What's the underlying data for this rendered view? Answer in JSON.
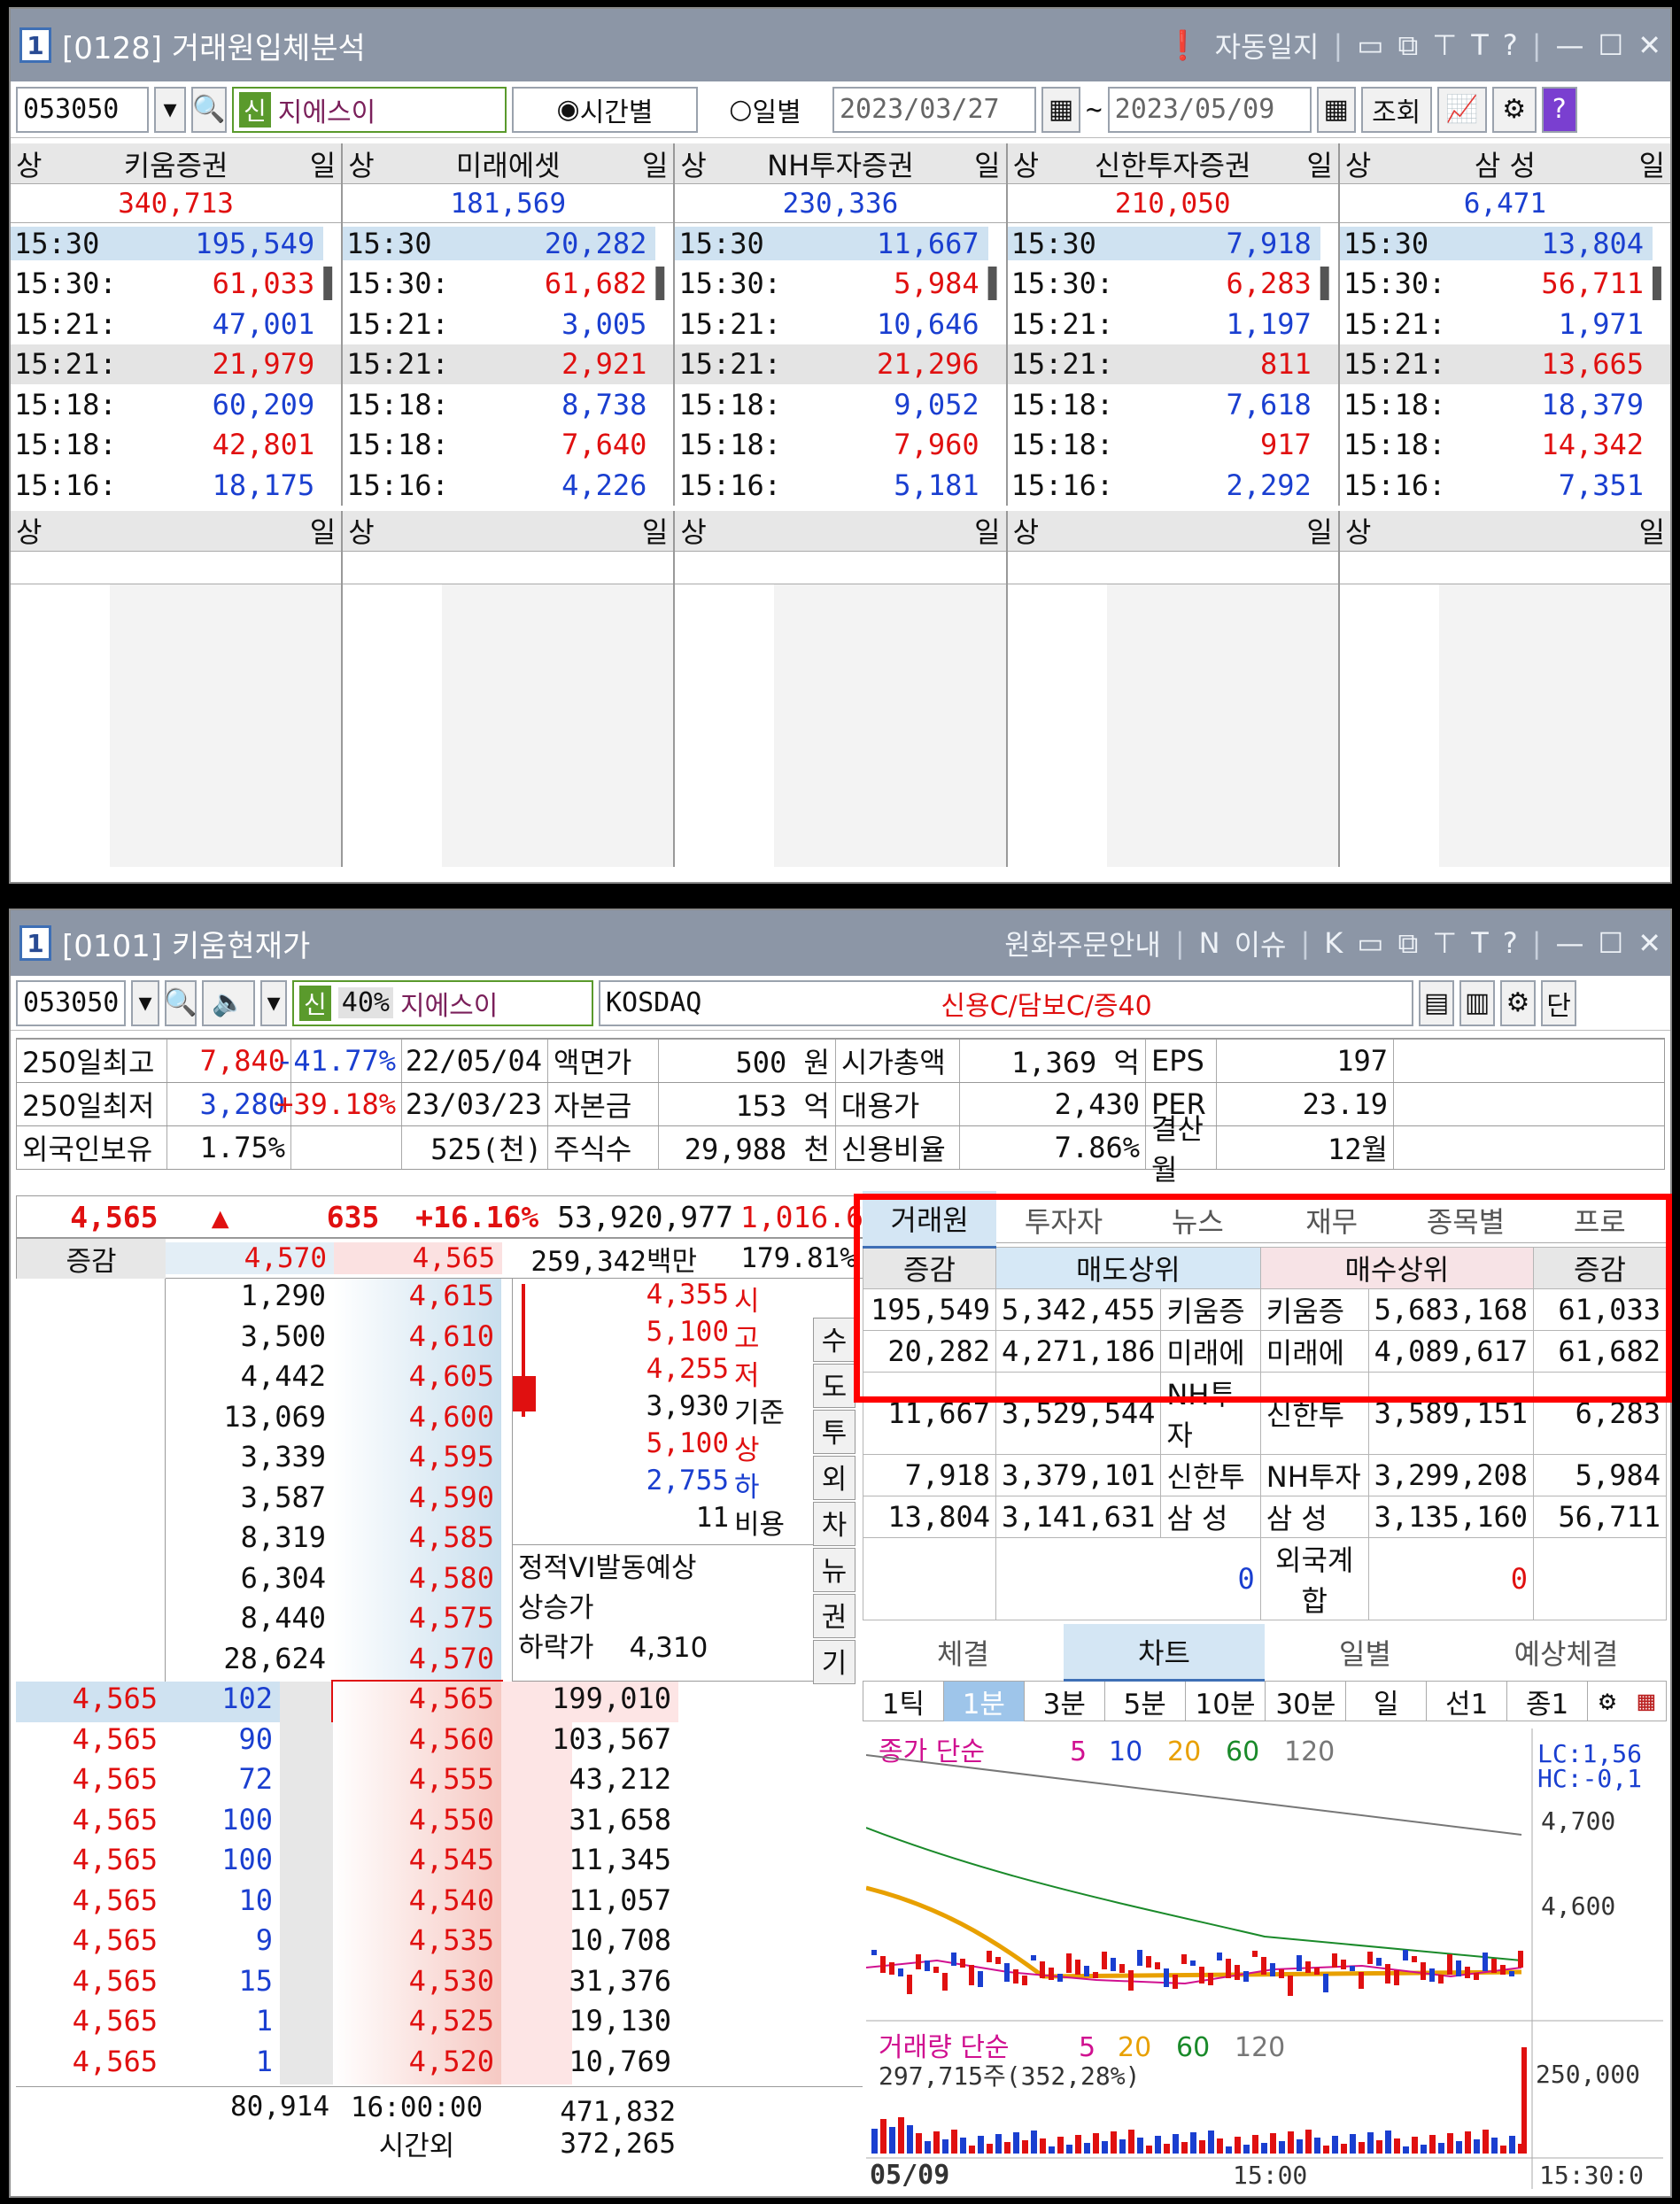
{
  "w1": {
    "num": "1",
    "title": "[0128] 거래원입체분석",
    "ctrl": "자동일지",
    "code": "053050",
    "badge": "신",
    "name": "지에스이",
    "radio1": "시간별",
    "radio2": "일별",
    "date_from": "2023/03/27",
    "tilde": "~",
    "date_to": "2023/05/09",
    "query": "조회",
    "help": "?",
    "brokers": [
      {
        "name": "키움증권",
        "total": "340,713",
        "tc": "red",
        "rows": [
          [
            "15:30:",
            "195,549",
            "blue"
          ],
          [
            "15:30:",
            "61,033",
            "red"
          ],
          [
            "15:21:",
            "47,001",
            "blue"
          ],
          [
            "15:21:",
            "21,979",
            "red"
          ],
          [
            "15:18:",
            "60,209",
            "blue"
          ],
          [
            "15:18:",
            "42,801",
            "red"
          ],
          [
            "15:16:",
            "18,175",
            "blue"
          ]
        ]
      },
      {
        "name": "미래에셋",
        "total": "181,569",
        "tc": "blue",
        "rows": [
          [
            "15:30:",
            "20,282",
            "blue"
          ],
          [
            "15:30:",
            "61,682",
            "red"
          ],
          [
            "15:21:",
            "3,005",
            "blue"
          ],
          [
            "15:21:",
            "2,921",
            "red"
          ],
          [
            "15:18:",
            "8,738",
            "blue"
          ],
          [
            "15:18:",
            "7,640",
            "red"
          ],
          [
            "15:16:",
            "4,226",
            "blue"
          ]
        ]
      },
      {
        "name": "NH투자증권",
        "total": "230,336",
        "tc": "blue",
        "rows": [
          [
            "15:30:",
            "11,667",
            "blue"
          ],
          [
            "15:30:",
            "5,984",
            "red"
          ],
          [
            "15:21:",
            "10,646",
            "blue"
          ],
          [
            "15:21:",
            "21,296",
            "red"
          ],
          [
            "15:18:",
            "9,052",
            "blue"
          ],
          [
            "15:18:",
            "7,960",
            "red"
          ],
          [
            "15:16:",
            "5,181",
            "blue"
          ]
        ]
      },
      {
        "name": "신한투자증권",
        "total": "210,050",
        "tc": "red",
        "rows": [
          [
            "15:30:",
            "7,918",
            "blue"
          ],
          [
            "15:30:",
            "6,283",
            "red"
          ],
          [
            "15:21:",
            "1,197",
            "blue"
          ],
          [
            "15:21:",
            "811",
            "red"
          ],
          [
            "15:18:",
            "7,618",
            "blue"
          ],
          [
            "15:18:",
            "917",
            "red"
          ],
          [
            "15:16:",
            "2,292",
            "blue"
          ]
        ]
      },
      {
        "name": "삼  성",
        "total": "6,471",
        "tc": "blue",
        "rows": [
          [
            "15:30:",
            "13,804",
            "blue"
          ],
          [
            "15:30:",
            "56,711",
            "red"
          ],
          [
            "15:21:",
            "1,971",
            "blue"
          ],
          [
            "15:21:",
            "13,665",
            "red"
          ],
          [
            "15:18:",
            "18,379",
            "blue"
          ],
          [
            "15:18:",
            "14,342",
            "red"
          ],
          [
            "15:16:",
            "7,351",
            "blue"
          ]
        ]
      }
    ],
    "hdr_l": "상",
    "hdr_r": "일"
  },
  "w2": {
    "num": "1",
    "title": "[0101] 키움현재가",
    "ctrl1": "원화주문안내",
    "ctrl2": "이슈",
    "code": "053050",
    "badge": "신",
    "pct": "40%",
    "name": "지에스이",
    "market": "KOSDAQ",
    "credit": "신용C/담보C/증40",
    "dan": "단",
    "info": [
      [
        "250일최고",
        "7,840",
        "-41.77%",
        "22/05/04",
        "액면가",
        "500 원",
        "시가총액",
        "1,369 억",
        "EPS",
        "197"
      ],
      [
        "250일최저",
        "3,280",
        "+39.18%",
        "23/03/23",
        "자본금",
        "153 억",
        "대용가",
        "2,430",
        "PER",
        "23.19"
      ],
      [
        "외국인보유",
        "1.75%",
        "",
        "525(천)",
        "주식수",
        "29,988 천",
        "신용비율",
        "7.86%",
        "결산월",
        "12월"
      ]
    ],
    "price": "4,565",
    "arrow": "▲",
    "chg": "635",
    "rate": "+16.16%",
    "vol": "53,920,977",
    "volr": "1,016.6",
    "sub": {
      "lbl": "증감",
      "p1": "4,570",
      "p2": "4,565",
      "amt": "259,342백만",
      "r": "179.81%"
    },
    "asks": [
      [
        "1,290",
        "4,615"
      ],
      [
        "3,500",
        "4,610"
      ],
      [
        "4,442",
        "4,605"
      ],
      [
        "13,069",
        "4,600"
      ],
      [
        "3,339",
        "4,595"
      ],
      [
        "3,587",
        "4,590"
      ],
      [
        "8,319",
        "4,585"
      ],
      [
        "6,304",
        "4,580"
      ],
      [
        "8,440",
        "4,575"
      ],
      [
        "28,624",
        "4,570"
      ]
    ],
    "ohlc": [
      [
        "4,355",
        "시",
        "red"
      ],
      [
        "5,100",
        "고",
        "red"
      ],
      [
        "4,255",
        "저",
        "red"
      ],
      [
        "3,930",
        "기준",
        "black"
      ],
      [
        "5,100",
        "상",
        "red"
      ],
      [
        "2,755",
        "하",
        "blue"
      ],
      [
        "11",
        "비용",
        "black"
      ]
    ],
    "side": [
      "수",
      "도",
      "투",
      "외",
      "차",
      "뉴",
      "권",
      "기"
    ],
    "vi": {
      "t": "정적VI발동예상",
      "up": "상승가",
      "dn": "하락가",
      "dv": "4,310"
    },
    "bids": [
      [
        "4,565",
        "102",
        "4,565",
        "199,010"
      ],
      [
        "4,565",
        "90",
        "4,560",
        "103,567"
      ],
      [
        "4,565",
        "72",
        "4,555",
        "43,212"
      ],
      [
        "4,565",
        "100",
        "4,550",
        "31,658"
      ],
      [
        "4,565",
        "100",
        "4,545",
        "11,345"
      ],
      [
        "4,565",
        "10",
        "4,540",
        "11,057"
      ],
      [
        "4,565",
        "9",
        "4,535",
        "10,708"
      ],
      [
        "4,565",
        "15",
        "4,530",
        "31,376"
      ],
      [
        "4,565",
        "1",
        "4,525",
        "19,130"
      ],
      [
        "4,565",
        "1",
        "4,520",
        "10,769"
      ]
    ],
    "foot": {
      "ask_total": "80,914",
      "time": "16:00:00",
      "bid_total": "471,832",
      "after": "시간외",
      "after_v": "372,265"
    },
    "tabs": [
      "거래원",
      "투자자",
      "뉴스",
      "재무",
      "종목별",
      "프로"
    ],
    "bt_head": [
      "증감",
      "매도상위",
      "매수상위",
      "증감"
    ],
    "bt": [
      [
        "195,549",
        "5,342,455",
        "키움증",
        "키움증",
        "5,683,168",
        "61,033"
      ],
      [
        "20,282",
        "4,271,186",
        "미래에",
        "미래에",
        "4,089,617",
        "61,682"
      ],
      [
        "11,667",
        "3,529,544",
        "NH투자",
        "신한투",
        "3,589,151",
        "6,283"
      ],
      [
        "7,918",
        "3,379,101",
        "신한투",
        "NH투자",
        "3,299,208",
        "5,984"
      ],
      [
        "13,804",
        "3,141,631",
        "삼  성",
        "삼  성",
        "3,135,160",
        "56,711"
      ]
    ],
    "foreign": [
      "0",
      "외국계합",
      "0"
    ],
    "tabs2": [
      "체결",
      "차트",
      "일별",
      "예상체결"
    ],
    "ctabs": [
      "1틱",
      "1분",
      "3분",
      "5분",
      "10분",
      "30분",
      "일",
      "선1",
      "종1"
    ],
    "chart": {
      "legend": "종가 단순",
      "ma": [
        "5",
        "10",
        "20",
        "60",
        "120"
      ],
      "lc": "LC:1,56",
      "hc": "HC:-0,1",
      "y1": "4,700",
      "y2": "4,600",
      "vlabel": "거래량 단순",
      "vma": [
        "5",
        "20",
        "60",
        "120"
      ],
      "vtext": "297,715주(352,28%)",
      "vy": "250,000",
      "date": "05/09",
      "tm": "15:00",
      "tm2": "15:30:0"
    }
  }
}
